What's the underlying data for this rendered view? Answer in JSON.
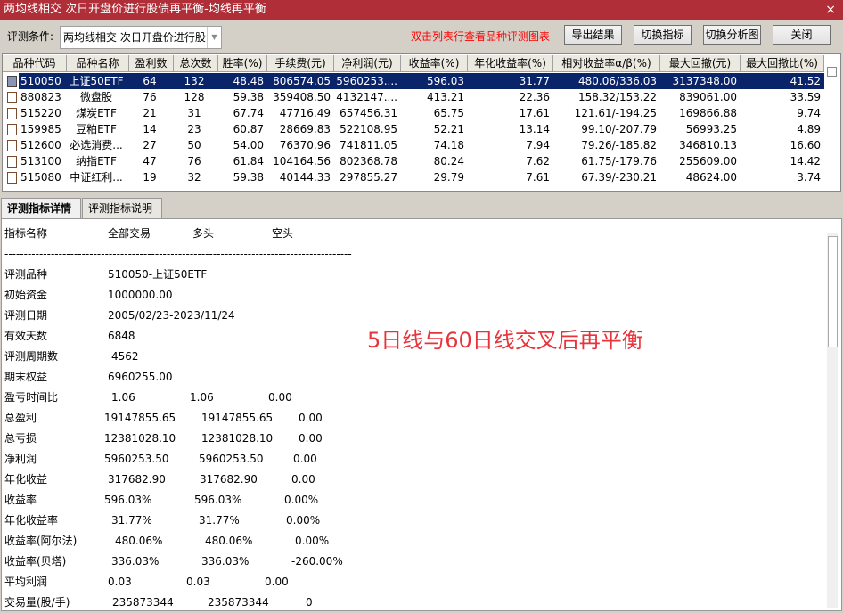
{
  "window": {
    "title": "两均线相交 次日开盘价进行股债再平衡-均线再平衡",
    "close_icon": "×"
  },
  "toolbar": {
    "condition_label": "评测条件:",
    "condition_value": "两均线相交 次日开盘价进行股",
    "hint": "双击列表行查看品种评测图表",
    "export": "导出结果",
    "switch_indicator": "切换指标",
    "switch_chart": "切换分析图",
    "close": "关闭"
  },
  "table": {
    "columns": [
      "品种代码",
      "品种名称",
      "盈利数",
      "总次数",
      "胜率(%)",
      "手续费(元)",
      "净利润(元)",
      "收益率(%)",
      "年化收益率(%)",
      "相对收益率α/β(%)",
      "最大回撤(元)",
      "最大回撤比(%)"
    ],
    "rows": [
      [
        "510050",
        "上证50ETF",
        "64",
        "132",
        "48.48",
        "806574.05",
        "5960253....",
        "596.03",
        "31.77",
        "480.06/336.03",
        "3137348.00",
        "41.52"
      ],
      [
        "880823",
        "微盘股",
        "76",
        "128",
        "59.38",
        "359408.50",
        "4132147....",
        "413.21",
        "22.36",
        "158.32/153.22",
        "839061.00",
        "33.59"
      ],
      [
        "515220",
        "煤炭ETF",
        "21",
        "31",
        "67.74",
        "47716.49",
        "657456.31",
        "65.75",
        "17.61",
        "121.61/-194.25",
        "169866.88",
        "9.74"
      ],
      [
        "159985",
        "豆粕ETF",
        "14",
        "23",
        "60.87",
        "28669.83",
        "522108.95",
        "52.21",
        "13.14",
        "99.10/-207.79",
        "56993.25",
        "4.89"
      ],
      [
        "512600",
        "必选消费...",
        "27",
        "50",
        "54.00",
        "76370.96",
        "741811.05",
        "74.18",
        "7.94",
        "79.26/-185.82",
        "346810.13",
        "16.60"
      ],
      [
        "513100",
        "纳指ETF",
        "47",
        "76",
        "61.84",
        "104164.56",
        "802368.78",
        "80.24",
        "7.62",
        "61.75/-179.76",
        "255609.00",
        "14.42"
      ],
      [
        "515080",
        "中证红利...",
        "19",
        "32",
        "59.38",
        "40144.33",
        "297855.27",
        "29.79",
        "7.61",
        "67.39/-230.21",
        "48624.00",
        "3.74"
      ]
    ]
  },
  "tabs": [
    "评测指标详情",
    "评测指标说明"
  ],
  "detail": {
    "headers": [
      "指标名称",
      "全部交易",
      "多头",
      "空头"
    ],
    "divider": "------------------------------------------------------------------------------------------",
    "rows": [
      [
        "评测品种",
        "510050-上证50ETF"
      ],
      [
        "初始资金",
        "1000000.00"
      ],
      [
        "评测日期",
        "2005/02/23-2023/11/24"
      ],
      [
        "有效天数",
        "6848"
      ],
      [
        "评测周期数",
        "4562"
      ],
      [
        "期末权益",
        "6960255.00"
      ],
      [
        "盈亏时间比",
        "1.06",
        "1.06",
        "0.00"
      ],
      [
        "总盈利",
        "19147855.65",
        "19147855.65",
        "0.00"
      ],
      [
        "总亏损",
        "12381028.10",
        "12381028.10",
        "0.00"
      ],
      [
        "净利润",
        "5960253.50",
        "5960253.50",
        "0.00"
      ],
      [
        "年化收益",
        "317682.90",
        "317682.90",
        "0.00"
      ],
      [
        "收益率",
        "596.03%",
        "596.03%",
        "0.00%"
      ],
      [
        "年化收益率",
        "31.77%",
        "31.77%",
        "0.00%"
      ],
      [
        "收益率(阿尔法)",
        "480.06%",
        "480.06%",
        "0.00%"
      ],
      [
        "收益率(贝塔)",
        "336.03%",
        "336.03%",
        "-260.00%"
      ],
      [
        "平均利润",
        "0.03",
        "0.03",
        "0.00"
      ],
      [
        "交易量(股/手)",
        "235873344",
        "235873344",
        "0"
      ]
    ],
    "annotation": "5日线与60日线交叉后再平衡"
  }
}
